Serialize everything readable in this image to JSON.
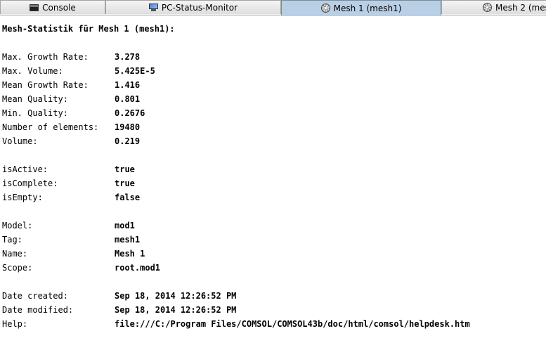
{
  "tabs": [
    {
      "label": "Console",
      "icon": "console-icon",
      "active": false
    },
    {
      "label": "PC-Status-Monitor",
      "icon": "monitor-icon",
      "active": false
    },
    {
      "label": "Mesh 1 (mesh1)",
      "icon": "mesh-icon",
      "active": true
    },
    {
      "label": "Mesh 2 (mes",
      "icon": "mesh-icon",
      "active": false
    }
  ],
  "heading": "Mesh-Statistik für Mesh 1 (mesh1):",
  "stats": [
    {
      "key": "Max. Growth Rate:",
      "value": "3.278"
    },
    {
      "key": "Max. Volume:",
      "value": "5.425E-5"
    },
    {
      "key": "Mean Growth Rate:",
      "value": "1.416"
    },
    {
      "key": "Mean Quality:",
      "value": "0.801"
    },
    {
      "key": "Min. Quality:",
      "value": "0.2676"
    },
    {
      "key": "Number of elements:",
      "value": "19480"
    },
    {
      "key": "Volume:",
      "value": "0.219"
    }
  ],
  "flags": [
    {
      "key": "isActive:",
      "value": "true"
    },
    {
      "key": "isComplete:",
      "value": "true"
    },
    {
      "key": "isEmpty:",
      "value": "false"
    }
  ],
  "identity": [
    {
      "key": "Model:",
      "value": "mod1"
    },
    {
      "key": "Tag:",
      "value": "mesh1"
    },
    {
      "key": "Name:",
      "value": "Mesh 1"
    },
    {
      "key": "Scope:",
      "value": "root.mod1"
    }
  ],
  "meta": [
    {
      "key": "Date created:",
      "value": "Sep 18, 2014 12:26:52 PM"
    },
    {
      "key": "Date modified:",
      "value": "Sep 18, 2014 12:26:52 PM"
    },
    {
      "key": "Help:",
      "value": "file:///C:/Program Files/COMSOL/COMSOL43b/doc/html/comsol/helpdesk.htm"
    }
  ],
  "colors": {
    "active_tab": "#b8cfe5",
    "inactive_tab": "#e6e6e6",
    "background": "#ffffff"
  }
}
